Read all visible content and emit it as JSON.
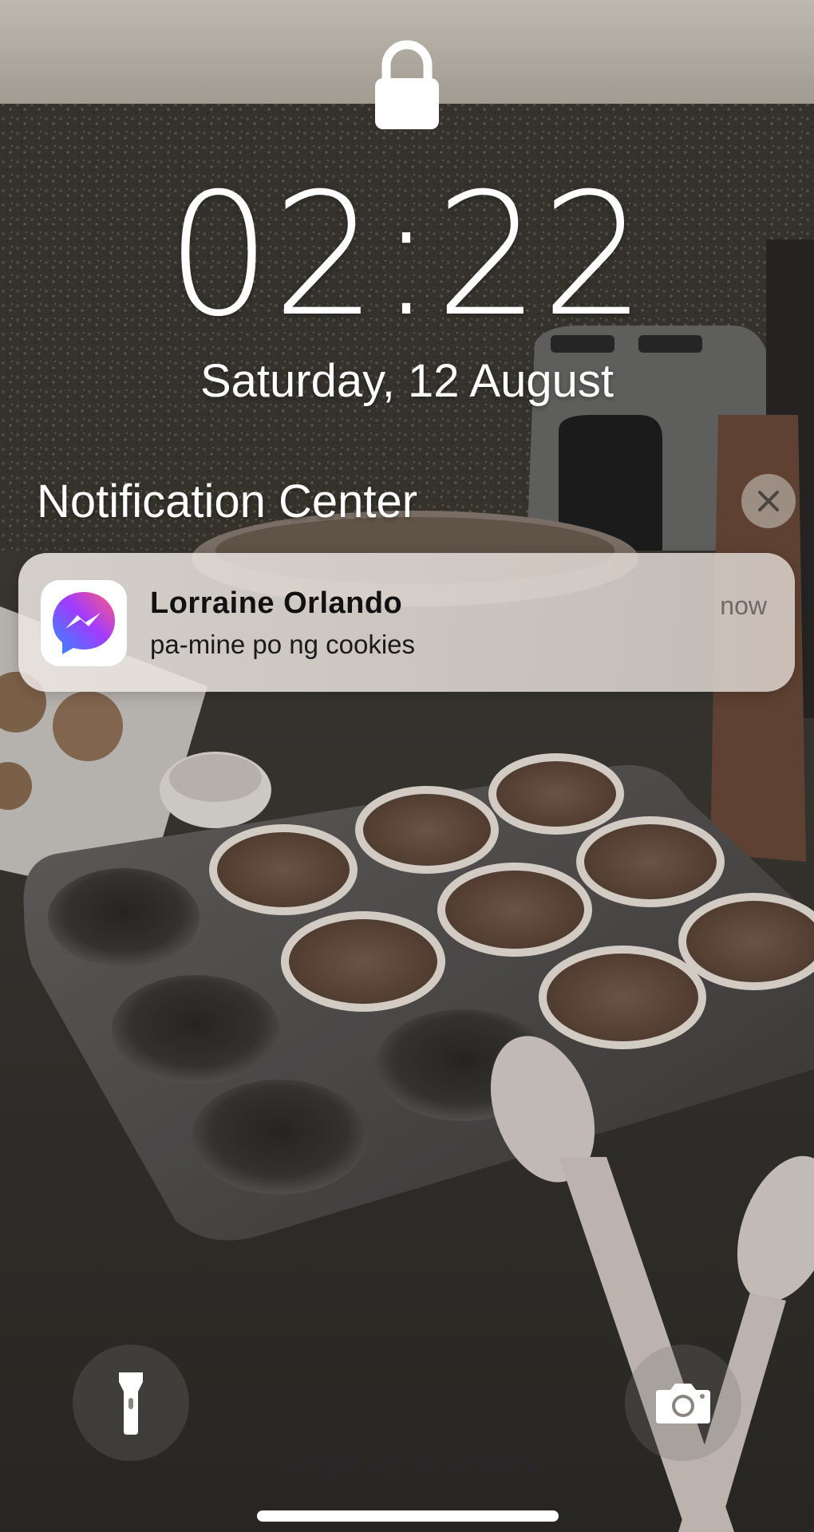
{
  "status": {
    "lock_icon": "lock-icon"
  },
  "clock": {
    "time": "02:22",
    "date": "Saturday, 12 August"
  },
  "notification_center": {
    "title": "Notification Center",
    "clear_icon": "close-icon",
    "notifications": [
      {
        "app_icon": "messenger-icon",
        "sender": "Lorraine Orlando",
        "message": "pa-mine po ng cookies",
        "time": "now"
      }
    ]
  },
  "quick_actions": {
    "left_icon": "flashlight-icon",
    "right_icon": "camera-icon"
  },
  "swipe_hint": "Swipe up to unlock",
  "colors": {
    "notification_bg": "#E9E3DE",
    "messenger_gradient_start": "#2E8CFF",
    "messenger_gradient_mid": "#A13BFF",
    "messenger_gradient_end": "#FF5C7A"
  }
}
